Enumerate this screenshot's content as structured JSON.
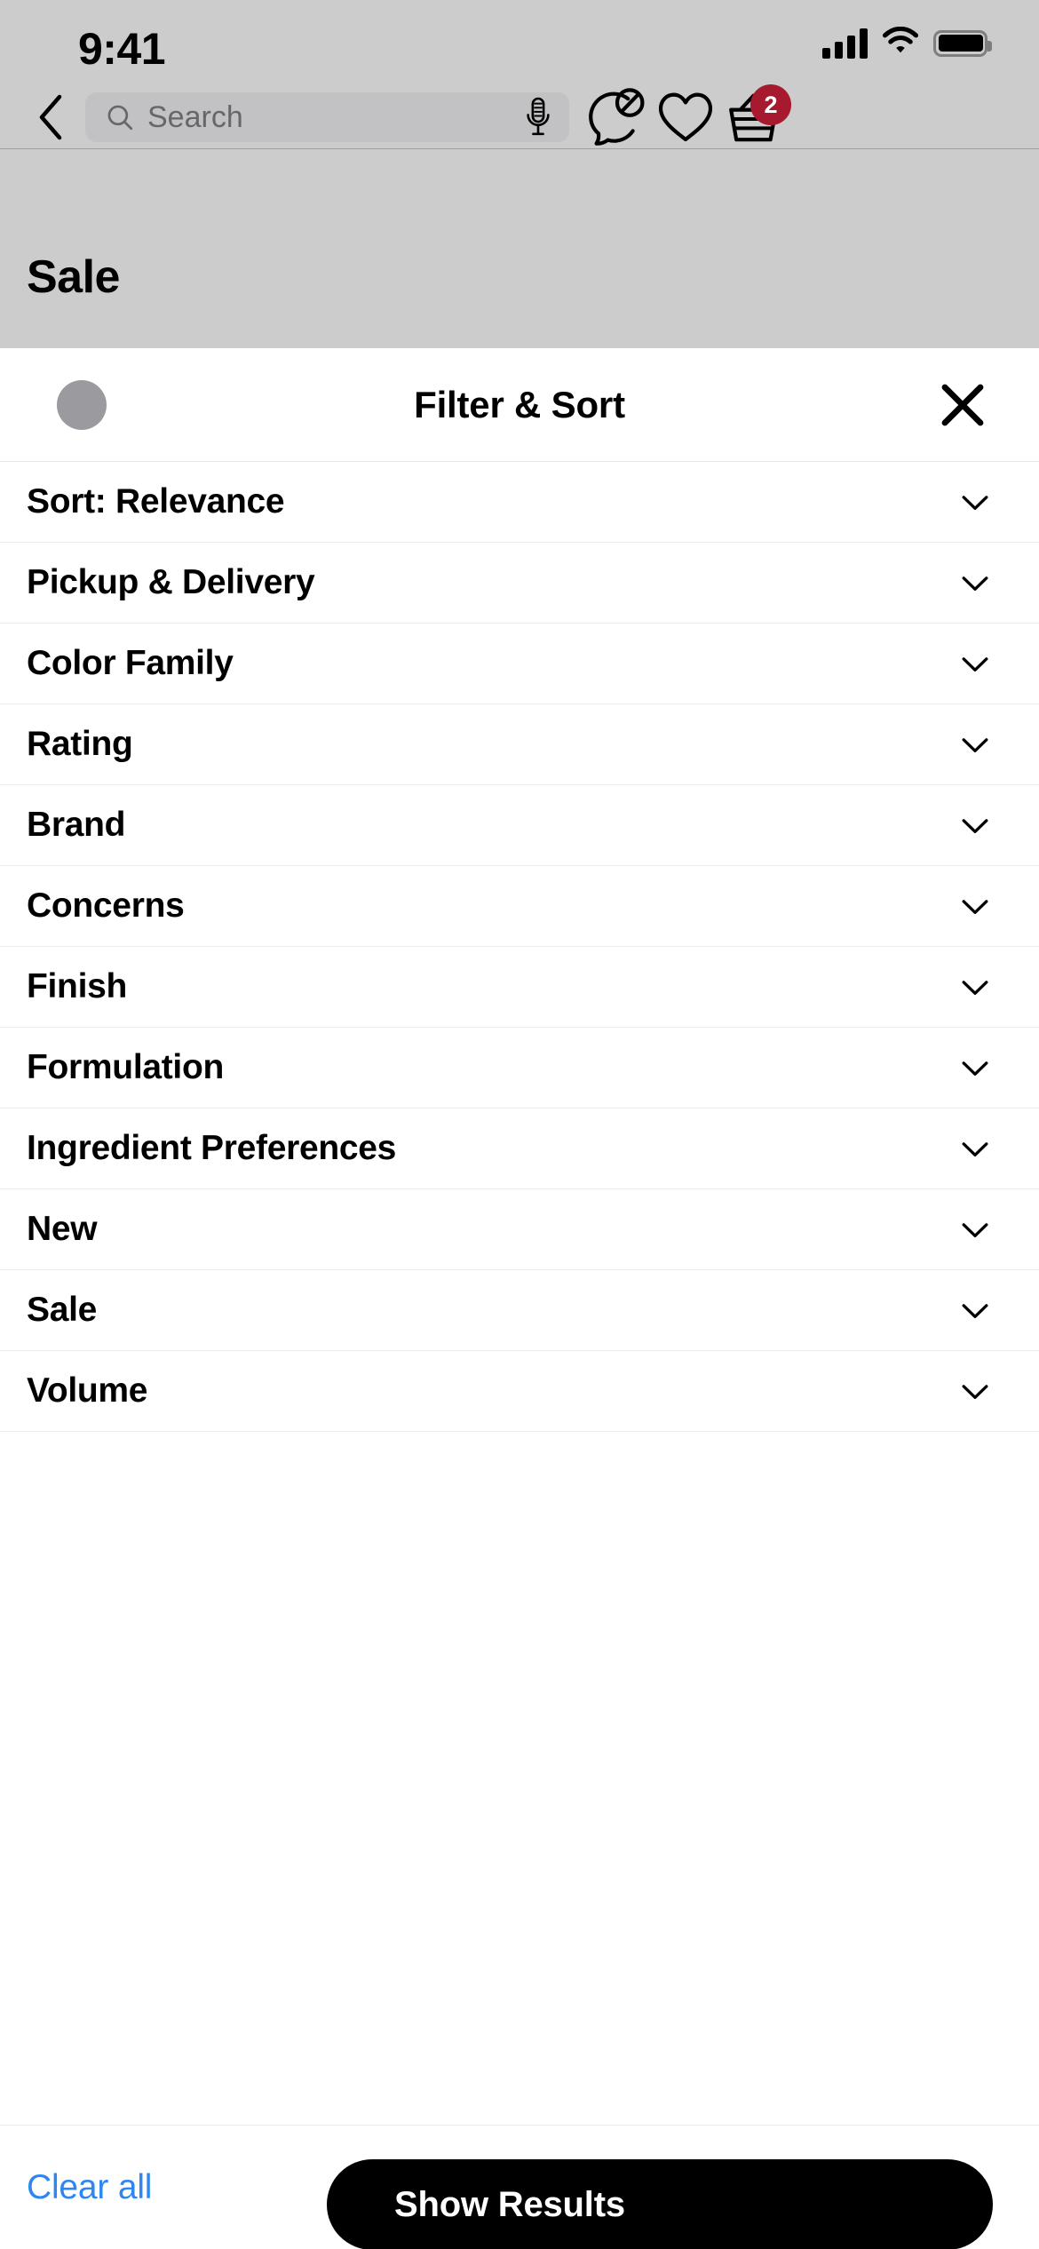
{
  "status_bar": {
    "time": "9:41",
    "cellular_icon": "cellular-signal-icon",
    "wifi_icon": "wifi-icon",
    "battery_icon": "battery-full-icon"
  },
  "nav_bar": {
    "back_icon": "chevron-left-icon",
    "search": {
      "placeholder": "Search",
      "value": "",
      "search_icon": "search-icon",
      "mic_icon": "microphone-icon"
    },
    "offers_icon": "chat-bubble-blocked-icon",
    "favorites_icon": "heart-icon",
    "basket_icon": "shopping-basket-icon",
    "basket_count": "2",
    "badge_color": "#a6192e"
  },
  "page": {
    "title": "Sale"
  },
  "sheet": {
    "title": "Filter & Sort",
    "grabber_icon": "drag-handle-dot",
    "close_icon": "close-icon",
    "rows": [
      {
        "label": "Sort: Relevance",
        "chevron": "chevron-down-icon"
      },
      {
        "label": "Pickup & Delivery",
        "chevron": "chevron-down-icon"
      },
      {
        "label": "Color Family",
        "chevron": "chevron-down-icon"
      },
      {
        "label": "Rating",
        "chevron": "chevron-down-icon"
      },
      {
        "label": "Brand",
        "chevron": "chevron-down-icon"
      },
      {
        "label": "Concerns",
        "chevron": "chevron-down-icon"
      },
      {
        "label": "Finish",
        "chevron": "chevron-down-icon"
      },
      {
        "label": "Formulation",
        "chevron": "chevron-down-icon"
      },
      {
        "label": "Ingredient Preferences",
        "chevron": "chevron-down-icon"
      },
      {
        "label": "New",
        "chevron": "chevron-down-icon"
      },
      {
        "label": "Sale",
        "chevron": "chevron-down-icon"
      },
      {
        "label": "Volume",
        "chevron": "chevron-down-icon"
      }
    ],
    "footer": {
      "clear_all_label": "Clear all",
      "clear_all_color": "#2e87f0",
      "show_results_label": "Show Results",
      "show_results_bg": "#000000"
    }
  }
}
